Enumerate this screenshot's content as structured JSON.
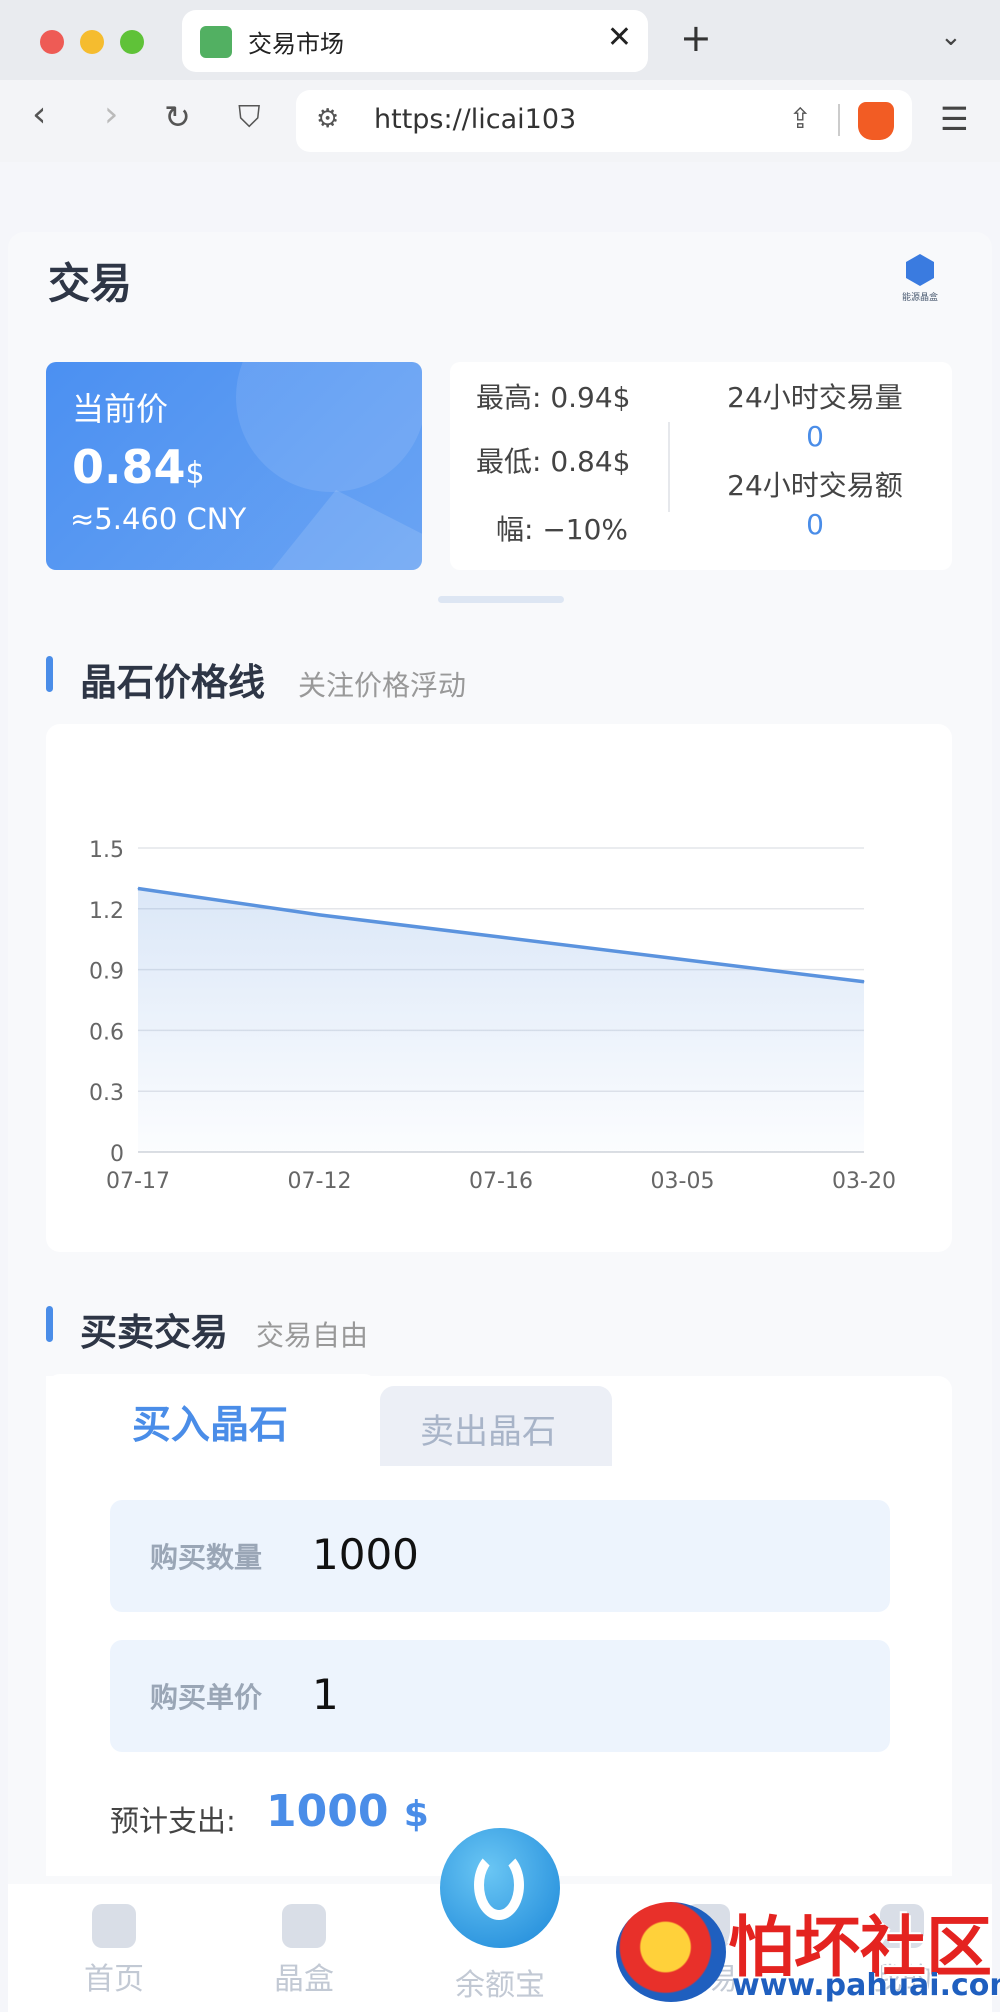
{
  "browser": {
    "tab_title": "交易市场",
    "url": "https://licai103"
  },
  "page": {
    "title": "交易",
    "brand_text": "能源晶盒"
  },
  "price_card": {
    "label": "当前价",
    "price": "0.84",
    "unit": "$",
    "cny": "≈5.460 CNY"
  },
  "stats": {
    "high": "最高: 0.94$",
    "low": "最低: 0.84$",
    "change": "幅: −10%",
    "volume_label": "24小时交易量",
    "volume_value": "0",
    "amount_label": "24小时交易额",
    "amount_value": "0"
  },
  "price_section": {
    "title": "晶石价格线",
    "subtitle": "关注价格浮动"
  },
  "chart_data": {
    "type": "area",
    "categories": [
      "07-17",
      "07-12",
      "07-16",
      "03-05",
      "03-20"
    ],
    "values": [
      1.3,
      1.17,
      1.06,
      0.95,
      0.84
    ],
    "y_ticks": [
      "0",
      "0.3",
      "0.6",
      "0.9",
      "1.2",
      "1.5"
    ],
    "ylim": [
      0,
      1.5
    ],
    "grid": true,
    "color": "#5b93de"
  },
  "trade_section": {
    "title": "买卖交易",
    "subtitle": "交易自由"
  },
  "trade": {
    "tab_buy": "买入晶石",
    "tab_sell": "卖出晶石",
    "quantity_label": "购买数量",
    "quantity_value": "1000",
    "unit_price_label": "购买单价",
    "unit_price_value": "1",
    "estimate_label": "预计支出:",
    "estimate_value": "1000",
    "estimate_unit": "$"
  },
  "bottom_nav": {
    "home": "首页",
    "box": "晶盒",
    "balance": "余额宝",
    "trade": "交易",
    "mine": "我的"
  },
  "watermark": {
    "title": "怕坏社区",
    "url": "www.pahuai.com"
  }
}
